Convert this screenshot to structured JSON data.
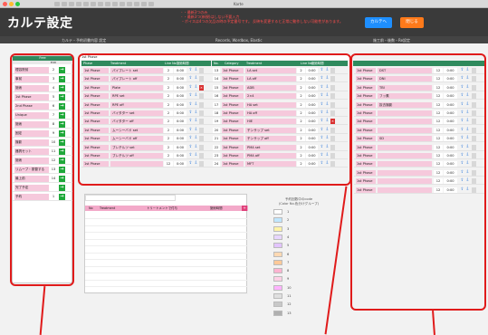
{
  "window": {
    "title": "Karte"
  },
  "header": {
    "title": "カルテ設定",
    "notice_lines": [
      "- ・最新3つのみ",
      "- ・最新3つ(新規)はしない不要入力",
      "・ボイスは4つの欠品の時の予定番号です。 反映を変更すると正常に動作しない可能性があります。"
    ],
    "karte_button": "カルテへ",
    "close_button": "閉じる"
  },
  "nav": {
    "left": "カルテ・予約初書内容 設定",
    "middle": "Records, Wordbox, Elastic",
    "right": "施工前・後数・Re設定"
  },
  "left_panel": {
    "header": "Free",
    "sub_header": "Edit",
    "items": [
      {
        "label": "理容院前",
        "num": "2"
      },
      {
        "label": "事前",
        "num": "3"
      },
      {
        "label": "施術",
        "num": "4"
      },
      {
        "label": "1st Phase",
        "num": "5"
      },
      {
        "label": "2nd Phase",
        "num": "6"
      },
      {
        "label": "Unique",
        "num": "7"
      },
      {
        "label": "施術",
        "num": "8"
      },
      {
        "label": "固定",
        "num": "9"
      },
      {
        "label": "撮影",
        "num": "10"
      },
      {
        "label": "器具セット",
        "num": "11"
      },
      {
        "label": "施術",
        "num": "12"
      },
      {
        "label": "リムーブ・振替する",
        "num": "13"
      },
      {
        "label": "最上前",
        "num": "14"
      },
      {
        "label": "完了予定",
        "num": ""
      },
      {
        "label": "予約",
        "num": "1"
      }
    ]
  },
  "main_table": {
    "phase_header": "1st Phase",
    "columns_left": [
      "Phase",
      "Treatment",
      "Line No",
      "施術時間"
    ],
    "columns_right": [
      "No.",
      "Category",
      "Treatment",
      "Line No",
      "施術時間"
    ],
    "rows_left": [
      {
        "phase": "1st Phase",
        "name": "パイプレート set",
        "line": "2",
        "time": "0:00",
        "no": "13"
      },
      {
        "phase": "1st Phase",
        "name": "パイプレート off",
        "line": "2",
        "time": "0:00",
        "no": "14"
      },
      {
        "phase": "1st Phase",
        "name": "Plate",
        "line": "2",
        "time": "0:00",
        "no": "15"
      },
      {
        "phase": "1st Phase",
        "name": "RPE set",
        "line": "2",
        "time": "0:00",
        "no": "16"
      },
      {
        "phase": "1st Phase",
        "name": "RPE off",
        "line": "2",
        "time": "0:00",
        "no": "17"
      },
      {
        "phase": "1st Phase",
        "name": "バイタター set",
        "line": "2",
        "time": "0:00",
        "no": "18"
      },
      {
        "phase": "1st Phase",
        "name": "バイタター off",
        "line": "2",
        "time": "0:00",
        "no": "19"
      },
      {
        "phase": "1st Phase",
        "name": "ムーシーバド set",
        "line": "2",
        "time": "0:00",
        "no": "20"
      },
      {
        "phase": "1st Phase",
        "name": "ムーシーバド off",
        "line": "2",
        "time": "0:00",
        "no": "21"
      },
      {
        "phase": "1st Phase",
        "name": "ブレチルツ set",
        "line": "2",
        "time": "0:00",
        "no": "22"
      },
      {
        "phase": "1st Phase",
        "name": "ブレチルツ off",
        "line": "2",
        "time": "0:00",
        "no": "23"
      },
      {
        "phase": "1st Phase",
        "name": "",
        "line": "12",
        "time": "0:00",
        "no": "24"
      }
    ],
    "rows_right": [
      {
        "phase": "1st Phase",
        "name": "LA set",
        "line": "2",
        "time": "0:00"
      },
      {
        "phase": "1st Phase",
        "name": "LA off",
        "line": "2",
        "time": "0:00"
      },
      {
        "phase": "1st Phase",
        "name": "ADB",
        "line": "2",
        "time": "0:00"
      },
      {
        "phase": "1st Phase",
        "name": "2×4",
        "line": "2",
        "time": "0:00"
      },
      {
        "phase": "1st Phase",
        "name": "HA set",
        "line": "2",
        "time": "0:00"
      },
      {
        "phase": "1st Phase",
        "name": "HA off",
        "line": "2",
        "time": "0:00"
      },
      {
        "phase": "1st Phase",
        "name": "HIE",
        "line": "2",
        "time": "0:00"
      },
      {
        "phase": "1st Phase",
        "name": "チンサップ set",
        "line": "2",
        "time": "0:00"
      },
      {
        "phase": "1st Phase",
        "name": "チンサップ off",
        "line": "2",
        "time": "0:00"
      },
      {
        "phase": "1st Phase",
        "name": "PMA set",
        "line": "2",
        "time": "0:00"
      },
      {
        "phase": "1st Phase",
        "name": "PMA off",
        "line": "2",
        "time": "0:00"
      },
      {
        "phase": "1st Phase",
        "name": "MFT",
        "line": "2",
        "time": "0:00"
      }
    ]
  },
  "right_panel": {
    "rows": [
      {
        "phase": "1st Phase",
        "name": "DST",
        "line": "12",
        "time": "0:00"
      },
      {
        "phase": "1st Phase",
        "name": "DNI",
        "line": "12",
        "time": "0:00"
      },
      {
        "phase": "1st Phase",
        "name": "TBI",
        "line": "12",
        "time": "0:00"
      },
      {
        "phase": "1st Phase",
        "name": "フッ素",
        "line": "12",
        "time": "0:00"
      },
      {
        "phase": "1st Phase",
        "name": "抜去撮影",
        "line": "12",
        "time": "0:00"
      },
      {
        "phase": "1st Phase",
        "name": "",
        "line": "12",
        "time": "0:00"
      },
      {
        "phase": "1st Phase",
        "name": "",
        "line": "12",
        "time": "0:00"
      },
      {
        "phase": "1st Phase",
        "name": "",
        "line": "12",
        "time": "0:00"
      },
      {
        "phase": "1st Phase",
        "name": "SD",
        "line": "12",
        "time": "0:00"
      },
      {
        "phase": "1st Phase",
        "name": "",
        "line": "12",
        "time": "0:00"
      },
      {
        "phase": "1st Phase",
        "name": "",
        "line": "12",
        "time": "0:00"
      },
      {
        "phase": "1st Phase",
        "name": "",
        "line": "12",
        "time": "0:00"
      },
      {
        "phase": "1st Phase",
        "name": "",
        "line": "12",
        "time": "0:00"
      },
      {
        "phase": "1st Phase",
        "name": "",
        "line": "12",
        "time": "0:00"
      },
      {
        "phase": "1st Phase",
        "name": "",
        "line": "12",
        "time": "0:00"
      }
    ]
  },
  "popup": {
    "columns": [
      "No",
      "Treatment",
      "トリートメントで付与",
      "施術時間"
    ]
  },
  "legend": {
    "title_line1": "予約回数中のcode",
    "title_line2": "(Color No.色分けグループ)",
    "items": [
      {
        "num": "1",
        "color": "#ffffff"
      },
      {
        "num": "2",
        "color": "#bfe6ff"
      },
      {
        "num": "3",
        "color": "#fff3a8"
      },
      {
        "num": "4",
        "color": "#e8d6ff"
      },
      {
        "num": "5",
        "color": "#e2c4ff"
      },
      {
        "num": "6",
        "color": "#ffd9b3"
      },
      {
        "num": "7",
        "color": "#ffc999"
      },
      {
        "num": "8",
        "color": "#ffb3d1"
      },
      {
        "num": "9",
        "color": "#ffd1e6"
      },
      {
        "num": "10",
        "color": "#ffb3ff"
      },
      {
        "num": "11",
        "color": "#e0e0e0"
      },
      {
        "num": "12",
        "color": "#c8c8c8"
      },
      {
        "num": "13",
        "color": "#b0b0b0"
      }
    ]
  },
  "colors": {
    "accent_blue": "#1e8fff",
    "accent_orange": "#ff7a1a",
    "row_pink": "#f6c9dc",
    "header_green": "#2f8a5d",
    "annotation_red": "#e01b1b"
  }
}
